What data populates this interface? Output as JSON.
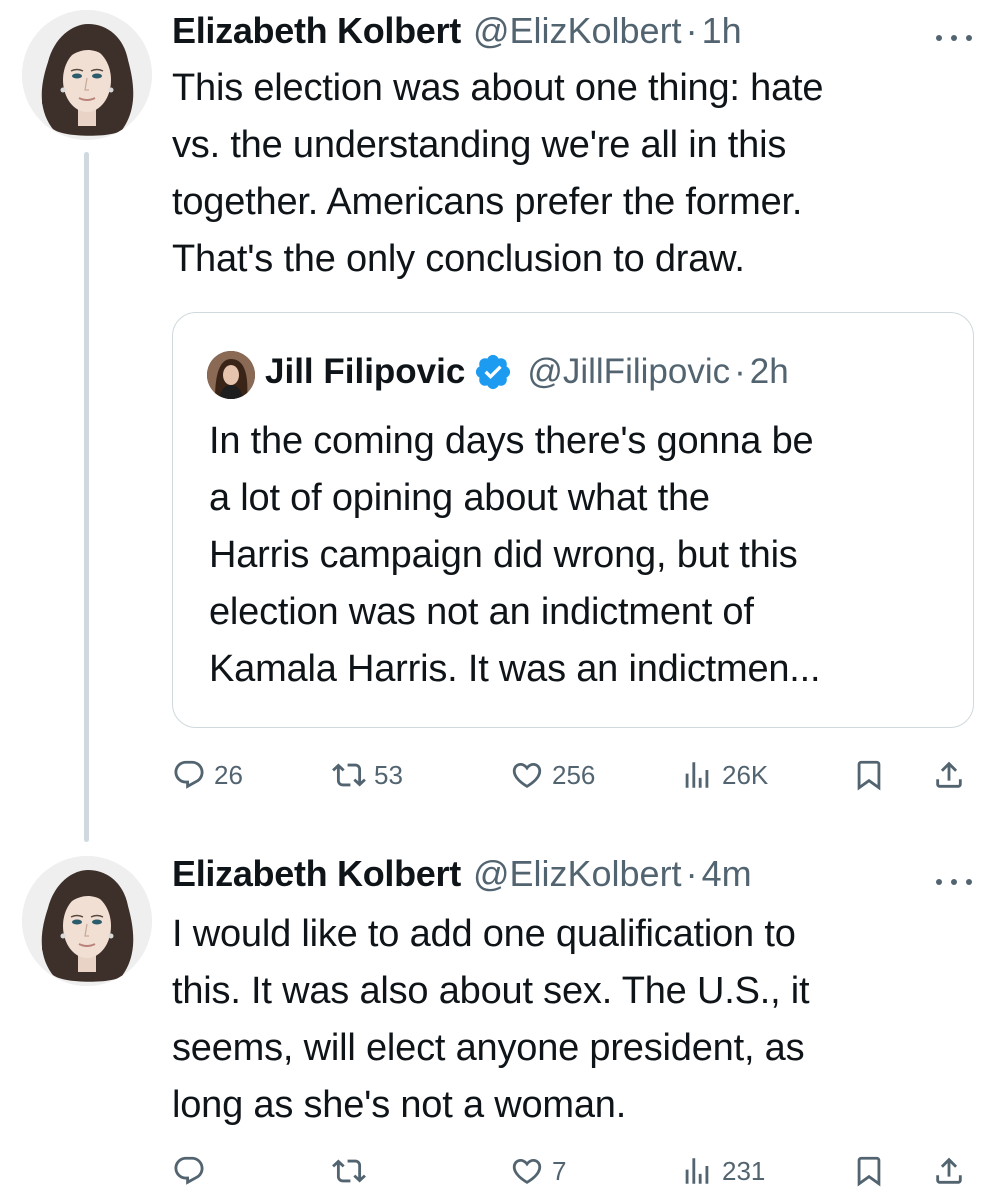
{
  "tweets": [
    {
      "author": {
        "name": "Elizabeth Kolbert",
        "handle": "@ElizKolbert",
        "avatar_icon": "illustrated-woman-avatar"
      },
      "separator": "·",
      "time": "1h",
      "text": "This election was about one thing: hate\nvs. the understanding we're all in this\ntogether. Americans prefer the former.\nThat's the only conclusion to draw.",
      "quoted": {
        "author": {
          "name": "Jill Filipovic",
          "handle": "@JillFilipovic",
          "verified": true,
          "avatar_icon": "photo-woman-avatar"
        },
        "separator": "·",
        "time": "2h",
        "text": "In the coming days there's gonna be\na lot of opining about what the\nHarris campaign did wrong, but this\nelection was not an indictment of\nKamala Harris. It was an indictmen..."
      },
      "actions": {
        "replies": "26",
        "retweets": "53",
        "likes": "256",
        "views": "26K"
      }
    },
    {
      "author": {
        "name": "Elizabeth Kolbert",
        "handle": "@ElizKolbert",
        "avatar_icon": "illustrated-woman-avatar"
      },
      "separator": "·",
      "time": "4m",
      "text": "I would like to add one qualification to\nthis. It was also about sex. The U.S., it\nseems, will elect anyone president, as\nlong as she's not a woman.",
      "actions": {
        "replies": "",
        "retweets": "",
        "likes": "7",
        "views": "231"
      }
    }
  ],
  "colors": {
    "text_primary": "#0f1419",
    "text_secondary": "#536471",
    "border": "#cfd9de",
    "verified_blue": "#1d9bf0",
    "avatar_bg": "#efefef",
    "hair": "#3d302a"
  },
  "icons": [
    "reply-icon",
    "retweet-icon",
    "like-icon",
    "views-icon",
    "bookmark-icon",
    "share-icon",
    "more-icon",
    "verified-badge-icon"
  ]
}
